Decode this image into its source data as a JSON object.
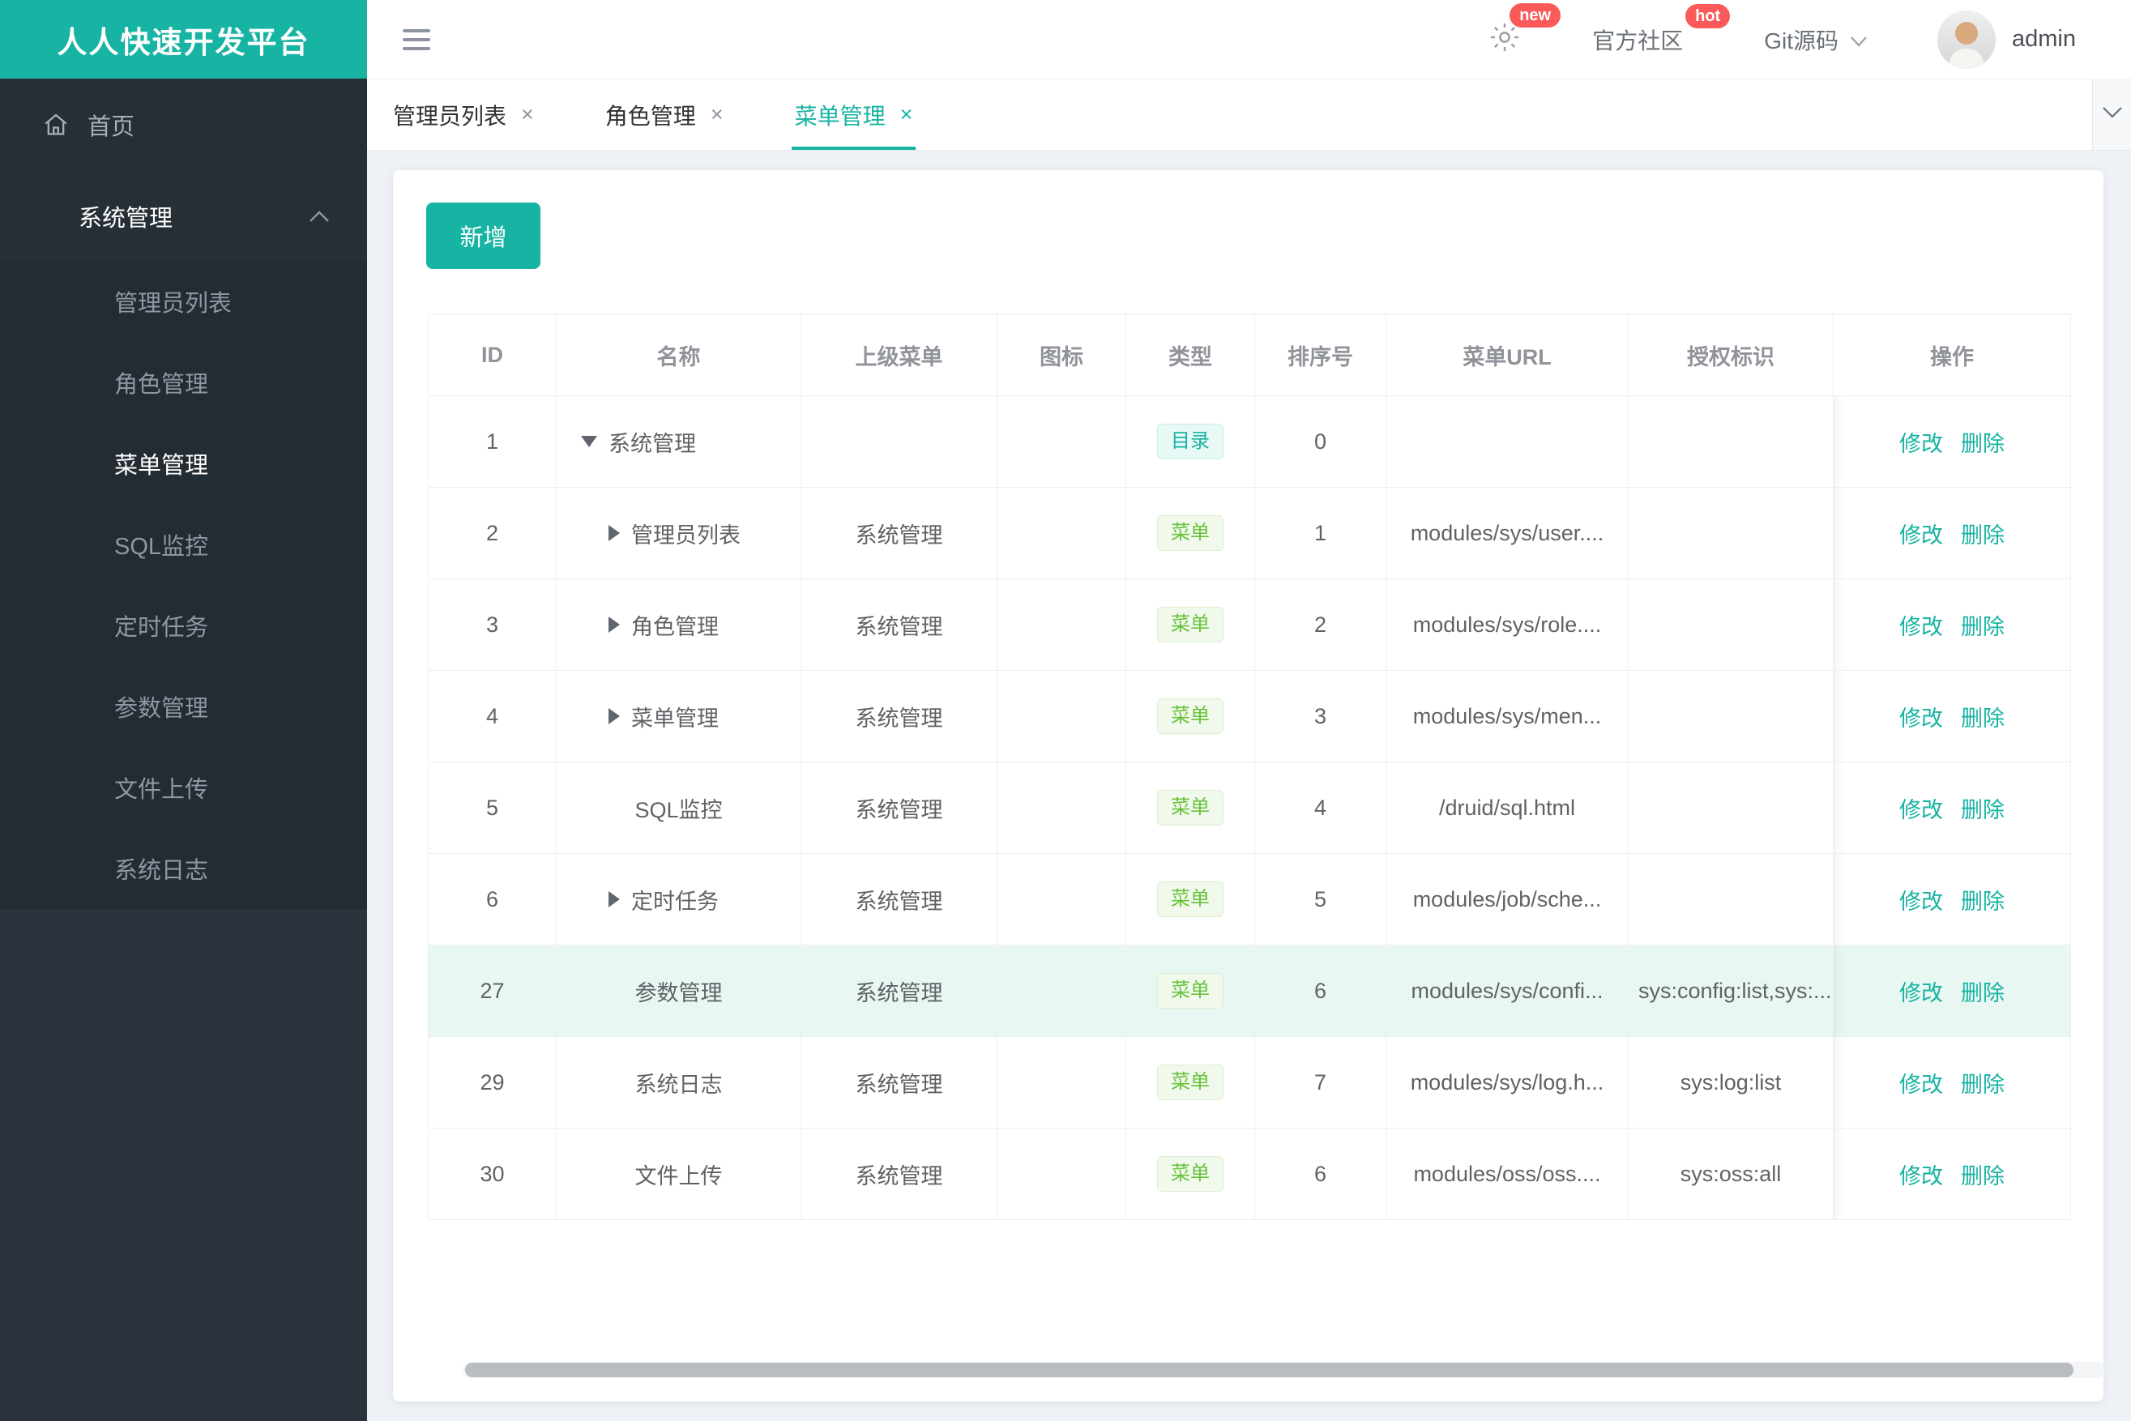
{
  "app": {
    "logo_title": "人人快速开发平台"
  },
  "colors": {
    "accent_teal": "#17B3A3",
    "badge_red": "#FA5A5A",
    "tag_dir_green": "#17B3A3",
    "tag_menu_green": "#67C23A",
    "sidebar_dark": "#2B343D",
    "row_highlight": "#E9F7F3"
  },
  "sidebar": {
    "home_label": "首页",
    "group": {
      "label": "系统管理",
      "expanded": true,
      "items": [
        {
          "label": "管理员列表",
          "active": false
        },
        {
          "label": "角色管理",
          "active": false
        },
        {
          "label": "菜单管理",
          "active": true
        },
        {
          "label": "SQL监控",
          "active": false
        },
        {
          "label": "定时任务",
          "active": false
        },
        {
          "label": "参数管理",
          "active": false
        },
        {
          "label": "文件上传",
          "active": false
        },
        {
          "label": "系统日志",
          "active": false
        }
      ]
    }
  },
  "topbar": {
    "gear_badge": "new",
    "community_label": "官方社区",
    "community_badge": "hot",
    "git_label": "Git源码",
    "username": "admin"
  },
  "tabbar": {
    "close_glyph": "×",
    "tabs": [
      {
        "label": "管理员列表",
        "active": false
      },
      {
        "label": "角色管理",
        "active": false
      },
      {
        "label": "菜单管理",
        "active": true
      }
    ]
  },
  "toolbar": {
    "add_label": "新增"
  },
  "table": {
    "columns": [
      "ID",
      "名称",
      "上级菜单",
      "图标",
      "类型",
      "排序号",
      "菜单URL",
      "授权标识",
      "操作"
    ],
    "actions": {
      "edit": "修改",
      "delete": "删除"
    },
    "rows": [
      {
        "id": "1",
        "name": "系统管理",
        "arrow": "down",
        "level": 0,
        "parent": "",
        "type": "目录",
        "order": "0",
        "url": "",
        "auth": "",
        "highlight": false
      },
      {
        "id": "2",
        "name": "管理员列表",
        "arrow": "right",
        "level": 1,
        "parent": "系统管理",
        "type": "菜单",
        "order": "1",
        "url": "modules/sys/user....",
        "auth": "",
        "highlight": false
      },
      {
        "id": "3",
        "name": "角色管理",
        "arrow": "right",
        "level": 1,
        "parent": "系统管理",
        "type": "菜单",
        "order": "2",
        "url": "modules/sys/role....",
        "auth": "",
        "highlight": false
      },
      {
        "id": "4",
        "name": "菜单管理",
        "arrow": "right",
        "level": 1,
        "parent": "系统管理",
        "type": "菜单",
        "order": "3",
        "url": "modules/sys/men...",
        "auth": "",
        "highlight": false
      },
      {
        "id": "5",
        "name": "SQL监控",
        "arrow": null,
        "level": 1,
        "parent": "系统管理",
        "type": "菜单",
        "order": "4",
        "url": "/druid/sql.html",
        "auth": "",
        "highlight": false
      },
      {
        "id": "6",
        "name": "定时任务",
        "arrow": "right",
        "level": 1,
        "parent": "系统管理",
        "type": "菜单",
        "order": "5",
        "url": "modules/job/sche...",
        "auth": "",
        "highlight": false
      },
      {
        "id": "27",
        "name": "参数管理",
        "arrow": null,
        "level": 1,
        "parent": "系统管理",
        "type": "菜单",
        "order": "6",
        "url": "modules/sys/confi...",
        "auth": "sys:config:list,sys:...",
        "highlight": true
      },
      {
        "id": "29",
        "name": "系统日志",
        "arrow": null,
        "level": 1,
        "parent": "系统管理",
        "type": "菜单",
        "order": "7",
        "url": "modules/sys/log.h...",
        "auth": "sys:log:list",
        "highlight": false
      },
      {
        "id": "30",
        "name": "文件上传",
        "arrow": null,
        "level": 1,
        "parent": "系统管理",
        "type": "菜单",
        "order": "6",
        "url": "modules/oss/oss....",
        "auth": "sys:oss:all",
        "highlight": false
      }
    ]
  }
}
